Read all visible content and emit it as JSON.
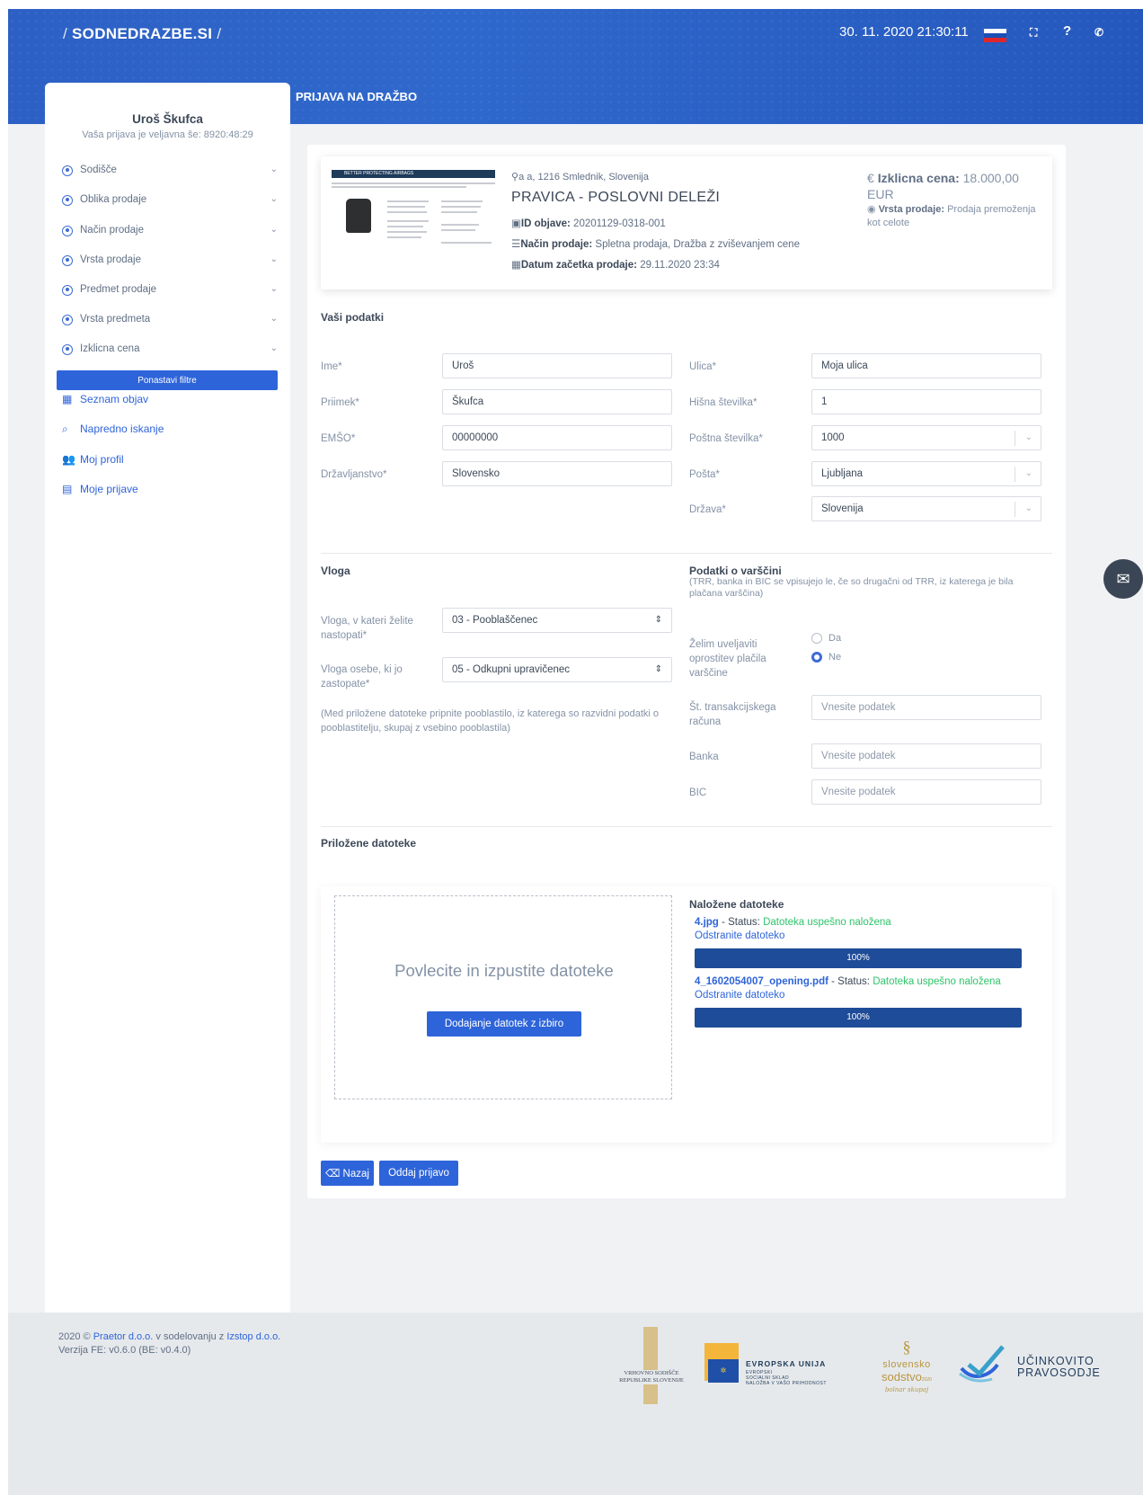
{
  "brand": "SODNEDRAZBE.SI",
  "header": {
    "datetime": "30. 11. 2020 21:30:11"
  },
  "user": {
    "name": "Uroš Škufca",
    "validity": "Vaša prijava je veljavna še: 8920:48:29"
  },
  "filters": [
    "Sodišče",
    "Oblika prodaje",
    "Način prodaje",
    "Vrsta prodaje",
    "Predmet prodaje",
    "Vrsta predmeta",
    "Izklicna cena"
  ],
  "reset_label": "Ponastavi filtre",
  "nav": [
    "Seznam objav",
    "Napredno iskanje",
    "Moj profil",
    "Moje prijave"
  ],
  "page_title": "PRIJAVA NA DRAŽBO",
  "listing": {
    "thumb_banner": "BETTER PROTECTING AIRBAGS",
    "location": "a a, 1216 Smlednik, Slovenija",
    "title": "PRAVICA - POSLOVNI DELEŽI",
    "id_label": "ID objave:",
    "id_value": "20201129-0318-001",
    "method_label": "Način prodaje:",
    "method_value": "Spletna prodaja, Dražba z zviševanjem cene",
    "start_label": "Datum začetka prodaje:",
    "start_value": "29.11.2020 23:34",
    "price_label": "Izklicna cena:",
    "price_value": "18.000,00",
    "price_currency": "EUR",
    "sale_type_label": "Vrsta prodaje:",
    "sale_type_value": "Prodaja premoženja kot celote"
  },
  "personal": {
    "title": "Vaši podatki",
    "ime_label": "Ime*",
    "ime": "Uroš",
    "priimek_label": "Priimek*",
    "priimek": "Škufca",
    "emso_label": "EMŠO*",
    "emso": "00000000",
    "drzavljanstvo_label": "Državljanstvo*",
    "drzavljanstvo": "Slovensko",
    "ulica_label": "Ulica*",
    "ulica": "Moja ulica",
    "hisna_label": "Hišna številka*",
    "hisna": "1",
    "postna_label": "Poštna številka*",
    "postna": "1000",
    "posta_label": "Pošta*",
    "posta": "Ljubljana",
    "drzava_label": "Država*",
    "drzava": "Slovenija"
  },
  "role": {
    "title": "Vloga",
    "role_label": "Vloga, v kateri želite nastopati*",
    "role_value": "03 - Pooblaščenec",
    "person_label": "Vloga osebe, ki jo zastopate*",
    "person_value": "05 - Odkupni upravičenec",
    "note": "(Med priložene datoteke pripnite pooblastilo, iz katerega so razvidni podatki o pooblastitelju, skupaj z vsebino pooblastila)"
  },
  "deposit": {
    "title": "Podatki o varščini",
    "subtitle": "(TRR, banka in BIC se vpisujejo le, če so drugačni od TRR, iz katerega je bila plačana varščina)",
    "exempt_label": "Želim uveljaviti oprostitev plačila varščine",
    "yes": "Da",
    "no": "Ne",
    "trr_label": "Št. transakcijskega računa",
    "bank_label": "Banka",
    "bic_label": "BIC",
    "placeholder": "Vnesite podatek"
  },
  "files": {
    "title": "Priložene datoteke",
    "drop_text": "Povlecite in izpustite datoteke",
    "choose_btn": "Dodajanje datotek z izbiro",
    "uploaded_title": "Naložene datoteke",
    "status_label": "Status:",
    "remove": "Odstranite datoteko",
    "items": [
      {
        "name": "4.jpg",
        "status": "Datoteka uspešno naložena",
        "progress": "100%"
      },
      {
        "name": "4_1602054007_opening.pdf",
        "status": "Datoteka uspešno naložena",
        "progress": "100%"
      }
    ]
  },
  "buttons": {
    "back": "Nazaj",
    "submit": "Oddaj prijavo"
  },
  "footer": {
    "year": "2020 ©",
    "company1": "Praetor d.o.o.",
    "in_collab": "v sodelovanju z",
    "company2": "Izstop d.o.o.",
    "version": "Verzija FE: v0.6.0 (BE: v0.4.0)",
    "court_logo": "VRHOVNO SODIŠČE REPUBLIKE SLOVENIJE",
    "eu_title": "EVROPSKA UNIJA",
    "eu_sub1": "EVROPSKI",
    "eu_sub2": "SOCIALNI SKLAD",
    "eu_sub3": "NALOŽBA V VAŠO PRIHODNOST",
    "ss_line1": "slovensko",
    "ss_line2": "sodstvo",
    "ss_year": "2020",
    "ss_script": "bolnar skupaj",
    "up_line1": "UČINKOVITO",
    "up_line2": "PRAVOSODJE"
  },
  "colors": {
    "primary": "#2e64d9",
    "header": "#2f68cc",
    "success": "#2ec46a",
    "progress": "#1f4c98"
  }
}
